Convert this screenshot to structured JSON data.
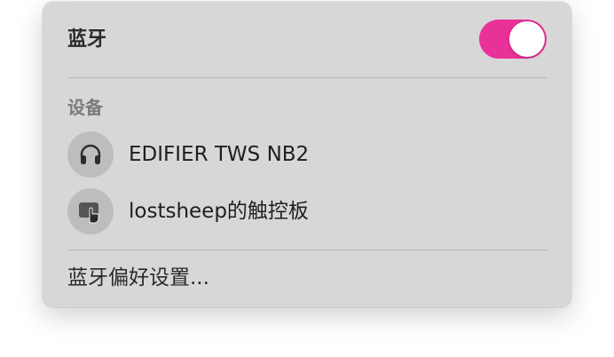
{
  "bluetooth": {
    "title": "蓝牙",
    "toggle_on": true,
    "accent_color": "#e9319a"
  },
  "devices_section": {
    "label": "设备",
    "items": [
      {
        "label": "EDIFIER TWS NB2",
        "icon": "headphones-icon"
      },
      {
        "label": "lostsheep的触控板",
        "icon": "trackpad-icon"
      }
    ]
  },
  "footer": {
    "preferences_label": "蓝牙偏好设置..."
  }
}
